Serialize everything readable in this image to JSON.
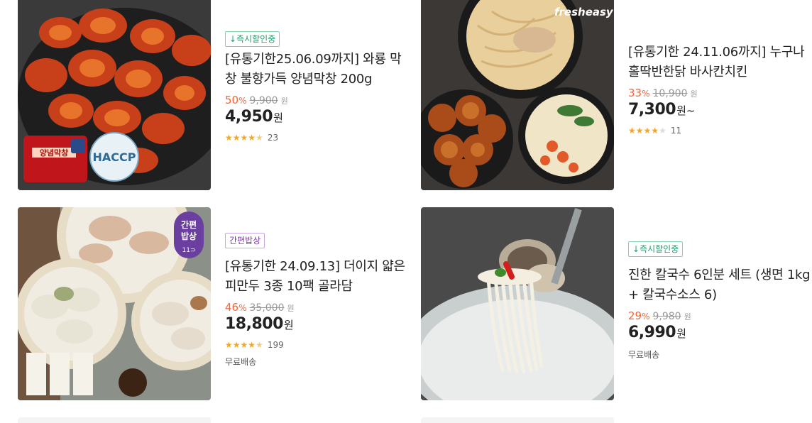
{
  "products": [
    {
      "badge": "↓즉시할인중",
      "badge_color": "green",
      "title": "[유통기한25.06.09까지] 와룡 막창 불향가득 양념막창 200g",
      "discount": "50",
      "discount_unit": "%",
      "original_price": "9,900",
      "original_unit": "원",
      "price": "4,950",
      "price_unit": "원",
      "price_suffix": "",
      "rating": 4.5,
      "review_count": "23",
      "delivery": "",
      "image_labels": {
        "package": "양념막창",
        "cert": "HACCP"
      }
    },
    {
      "badge": "",
      "badge_color": "",
      "title": "[유통기한 24.11.06까지] 누구나홀딱반한닭 바사칸치킨",
      "discount": "33",
      "discount_unit": "%",
      "original_price": "10,900",
      "original_unit": "원",
      "price": "7,300",
      "price_unit": "원",
      "price_suffix": "~",
      "rating": 4,
      "review_count": "11",
      "delivery": "",
      "image_labels": {
        "brand": "fresheasy"
      }
    },
    {
      "badge": "간편밥상",
      "badge_color": "purple",
      "title": "[유통기한 24.09.13] 더이지 얇은피만두 3종 10팩 골라담",
      "discount": "46",
      "discount_unit": "%",
      "original_price": "35,000",
      "original_unit": "원",
      "price": "18,800",
      "price_unit": "원",
      "price_suffix": "",
      "rating": 4.5,
      "review_count": "199",
      "delivery": "무료배송",
      "image_labels": {
        "tag_line1": "간편",
        "tag_line2": "밥상",
        "tag_line3": "11⊃"
      }
    },
    {
      "badge": "↓즉시할인중",
      "badge_color": "green",
      "title": "진한 칼국수 6인분 세트 (생면 1kg + 칼국수소스 6)",
      "discount": "29",
      "discount_unit": "%",
      "original_price": "9,980",
      "original_unit": "원",
      "price": "6,990",
      "price_unit": "원",
      "price_suffix": "",
      "rating": 0,
      "review_count": "",
      "delivery": "무료배송",
      "image_labels": {}
    }
  ]
}
